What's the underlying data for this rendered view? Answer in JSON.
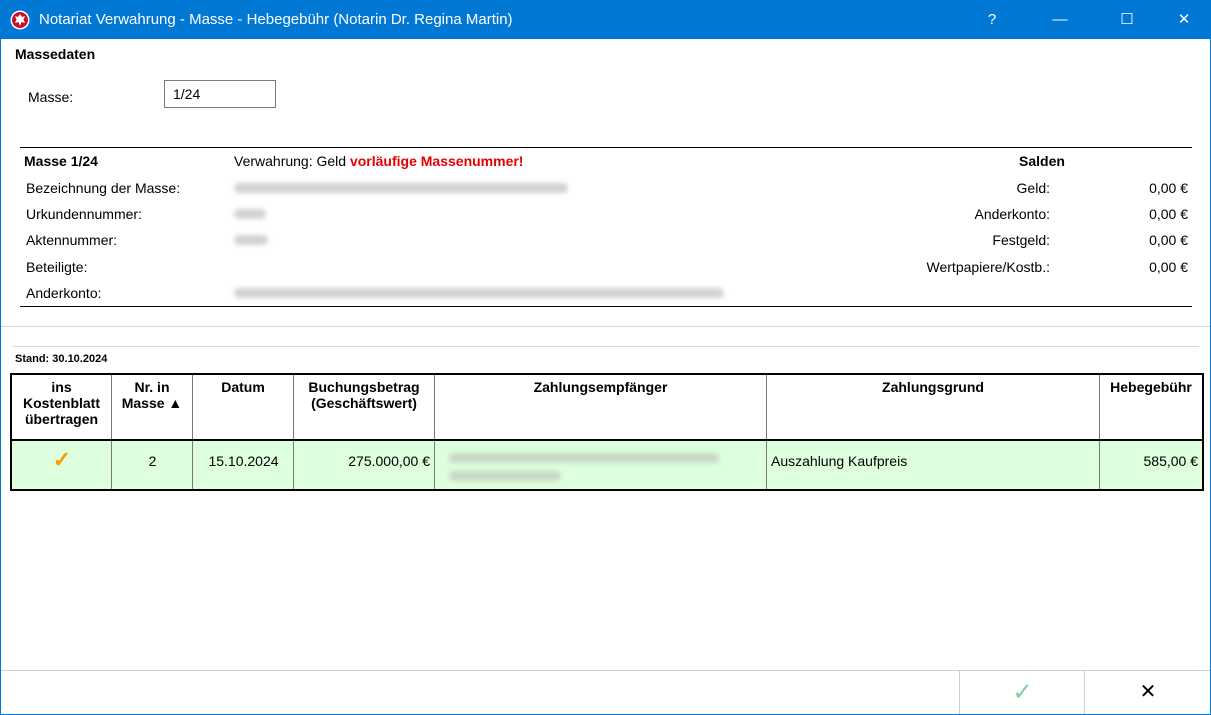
{
  "window": {
    "title": "Notariat Verwahrung - Masse - Hebegebühr (Notarin Dr. Regina Martin)",
    "controls": {
      "help": "?",
      "minimize": "—",
      "maximize": "☐",
      "close": "✕"
    },
    "colors": {
      "titlebar": "#0078d4",
      "accent_red": "#e60000",
      "row_highlight": "#ddffdd",
      "check_orange": "#f5a000"
    }
  },
  "massedaten": {
    "section_title": "Massedaten",
    "masse_label": "Masse:",
    "masse_value": "1/24"
  },
  "info": {
    "masse_heading": "Masse 1/24",
    "verwahrung_prefix": "Verwahrung: Geld",
    "warning": "vorläufige Massenummer!",
    "labels": {
      "bezeichnung": "Bezeichnung der Masse:",
      "urkundennummer": "Urkundennummer:",
      "aktennummer": "Aktennummer:",
      "beteiligte": "Beteiligte:",
      "anderkonto": "Anderkonto:"
    },
    "salden": {
      "title": "Salden",
      "rows": [
        {
          "label": "Geld:",
          "value": "0,00 €"
        },
        {
          "label": "Anderkonto:",
          "value": "0,00 €"
        },
        {
          "label": "Festgeld:",
          "value": "0,00 €"
        },
        {
          "label": "Wertpapiere/Kostb.:",
          "value": "0,00 €"
        }
      ]
    }
  },
  "stand": "Stand: 30.10.2024",
  "table": {
    "headers": {
      "ins": "ins",
      "kostenblatt": "Kostenblatt",
      "uebertragen": "übertragen",
      "nr_in": "Nr. in",
      "masse": "Masse ▲",
      "datum": "Datum",
      "buchungsbetrag": "Buchungsbetrag",
      "geschaeftswert": "(Geschäftswert)",
      "zahlungsempfaenger": "Zahlungsempfänger",
      "zahlungsgrund": "Zahlungsgrund",
      "hebegebuehr": "Hebegebühr"
    },
    "rows": [
      {
        "checked_icon": "✓",
        "nr": "2",
        "datum": "15.10.2024",
        "betrag": "275.000,00 €",
        "zahlungsgrund": "Auszahlung Kaufpreis",
        "hebegebuehr": "585,00 €"
      }
    ]
  },
  "footer": {
    "ok_icon": "✓",
    "cancel_icon": "✕"
  }
}
